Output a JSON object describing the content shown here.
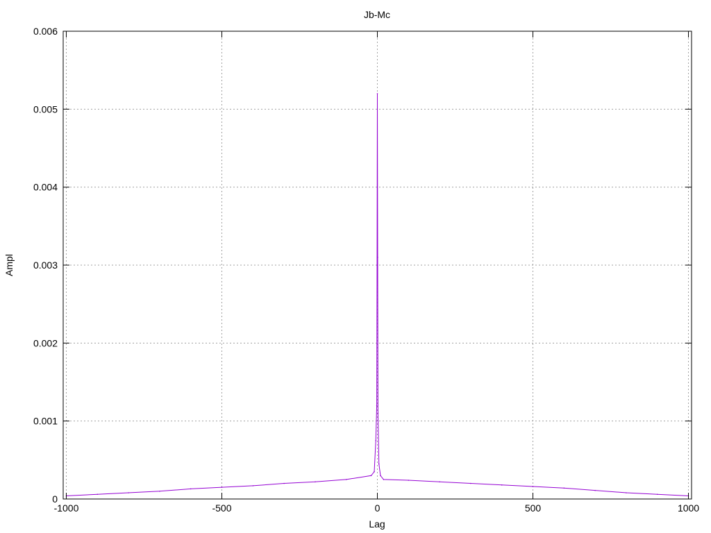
{
  "chart_data": {
    "type": "line",
    "title": "Jb-Mc",
    "xlabel": "Lag",
    "ylabel": "Ampl",
    "xlim": [
      -1010,
      1010
    ],
    "ylim": [
      0,
      0.006
    ],
    "xticks": [
      -1000,
      -500,
      0,
      500,
      1000
    ],
    "xtick_labels": [
      "-1000",
      "-500",
      "0",
      "500",
      "1000"
    ],
    "yticks": [
      0,
      0.001,
      0.002,
      0.003,
      0.004,
      0.005,
      0.006
    ],
    "ytick_labels": [
      "0",
      "0.001",
      "0.002",
      "0.003",
      "0.004",
      "0.005",
      "0.006"
    ],
    "grid": true,
    "line_color": "#9400d3",
    "series": [
      {
        "x": [
          -1000,
          -900,
          -800,
          -700,
          -600,
          -500,
          -400,
          -300,
          -200,
          -100,
          -20,
          -10,
          -5,
          -2,
          -1,
          0,
          1,
          2,
          5,
          10,
          20,
          100,
          200,
          300,
          400,
          500,
          600,
          700,
          800,
          900,
          1000
        ],
        "values": [
          4e-05,
          6e-05,
          8e-05,
          0.0001,
          0.00013,
          0.00015,
          0.00017,
          0.0002,
          0.00022,
          0.00025,
          0.0003,
          0.00035,
          0.00075,
          0.0012,
          0.003,
          0.0052,
          0.0031,
          0.0011,
          0.00045,
          0.0003,
          0.00025,
          0.00024,
          0.00022,
          0.0002,
          0.00018,
          0.00016,
          0.00014,
          0.00011,
          8e-05,
          6e-05,
          4e-05
        ]
      }
    ]
  }
}
